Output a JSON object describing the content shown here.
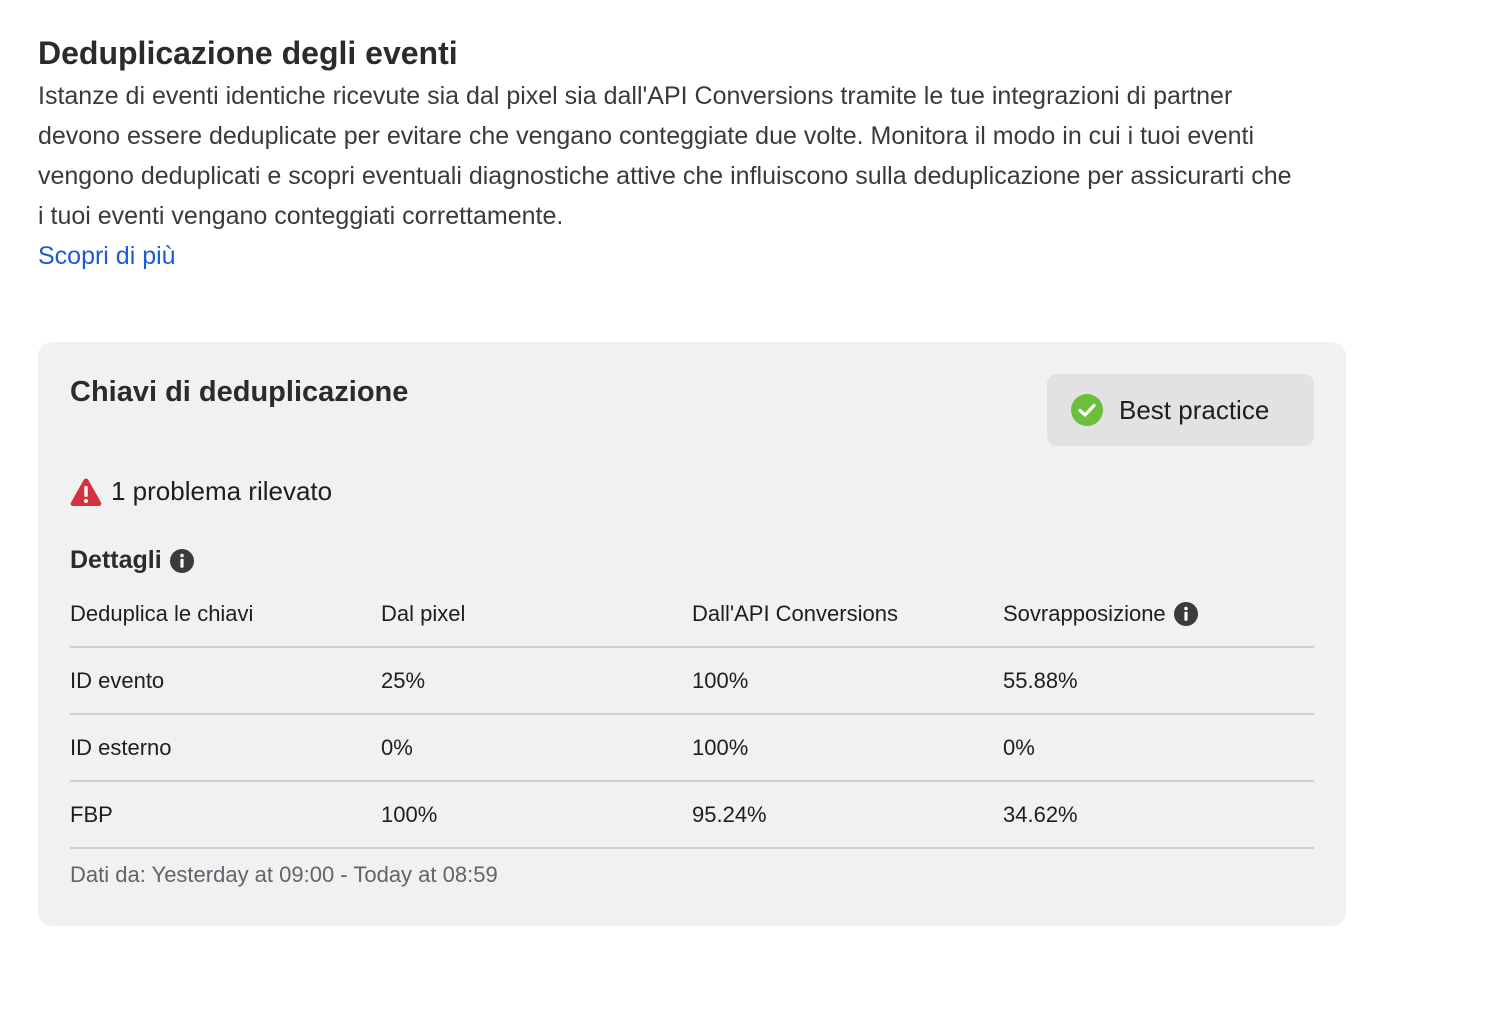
{
  "header": {
    "title": "Deduplicazione degli eventi",
    "description": "Istanze di eventi identiche ricevute sia dal pixel sia dall'API Conversions tramite le tue integrazioni di partner devono essere deduplicate per evitare che vengano conteggiate due volte. Monitora il modo in cui i tuoi eventi vengono deduplicati e scopri eventuali diagnostiche attive che influiscono sulla deduplicazione per assicurarti che i tuoi eventi vengano conteggiati correttamente.",
    "learn_more": "Scopri di più"
  },
  "card": {
    "title": "Chiavi di deduplicazione",
    "badge": {
      "label": "Best practice",
      "icon": "check-circle-icon",
      "color": "#6bbf3a"
    },
    "issue": {
      "text": "1 problema rilevato",
      "icon": "warning-triangle-icon",
      "color": "#d6303f"
    },
    "details_label": "Dettagli",
    "table": {
      "headers": [
        "Deduplica le chiavi",
        "Dal pixel",
        "Dall'API Conversions",
        "Sovrapposizione"
      ],
      "rows": [
        [
          "ID evento",
          "25%",
          "100%",
          "55.88%"
        ],
        [
          "ID esterno",
          "0%",
          "100%",
          "0%"
        ],
        [
          "FBP",
          "100%",
          "95.24%",
          "34.62%"
        ]
      ]
    },
    "footer_note": "Dati da: Yesterday at 09:00 - Today at 08:59"
  },
  "colors": {
    "link": "#1d5bd6",
    "card_background": "#f1f1f1",
    "badge_background": "#e2e2e2"
  }
}
